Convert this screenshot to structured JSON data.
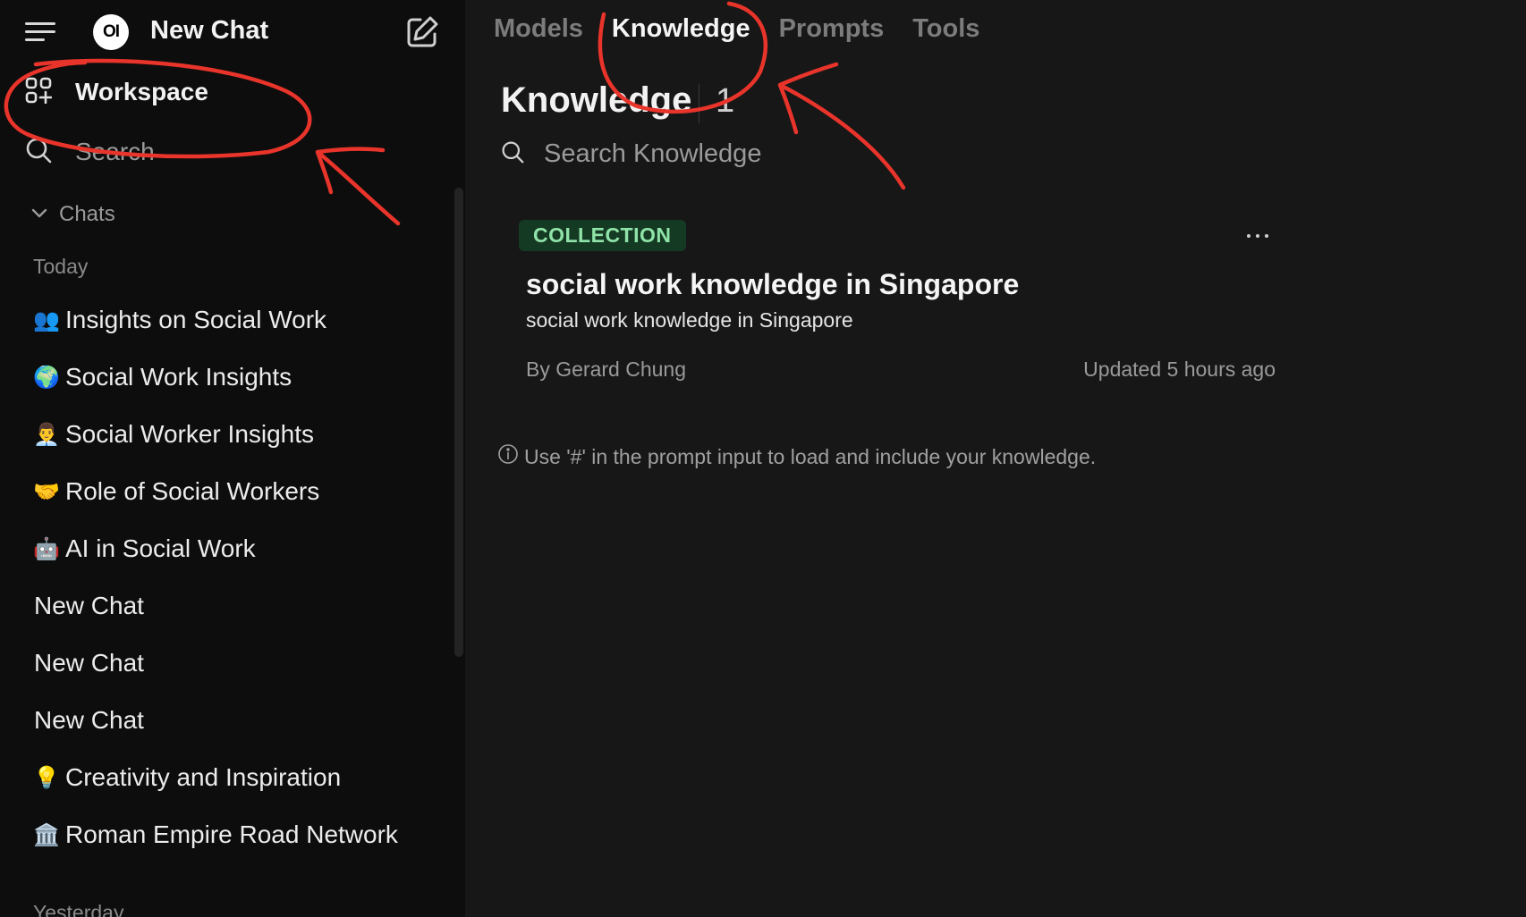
{
  "sidebar": {
    "app_title": "New Chat",
    "logo_text": "OI",
    "nav": {
      "workspace": "Workspace",
      "search": "Search"
    },
    "chats_header": "Chats",
    "groups": {
      "today": "Today",
      "yesterday": "Yesterday"
    },
    "chats": [
      {
        "emoji": "👥",
        "title": "Insights on Social Work"
      },
      {
        "emoji": "🌍",
        "title": "Social Work Insights"
      },
      {
        "emoji": "👨‍💼",
        "title": "Social Worker Insights"
      },
      {
        "emoji": "🤝",
        "title": "Role of Social Workers"
      },
      {
        "emoji": "🤖",
        "title": "AI in Social Work"
      },
      {
        "emoji": "",
        "title": "New Chat"
      },
      {
        "emoji": "",
        "title": "New Chat"
      },
      {
        "emoji": "",
        "title": "New Chat"
      },
      {
        "emoji": "💡",
        "title": "Creativity and Inspiration"
      },
      {
        "emoji": "🏛️",
        "title": "Roman Empire Road Network"
      }
    ]
  },
  "main": {
    "tabs": [
      {
        "label": "Models",
        "active": false
      },
      {
        "label": "Knowledge",
        "active": true
      },
      {
        "label": "Prompts",
        "active": false
      },
      {
        "label": "Tools",
        "active": false
      }
    ],
    "heading": "Knowledge",
    "count": "1",
    "search_placeholder": "Search Knowledge",
    "card": {
      "badge": "COLLECTION",
      "title": "social work knowledge in Singapore",
      "description": "social work knowledge in Singapore",
      "author": "By Gerard Chung",
      "updated": "Updated 5 hours ago"
    },
    "hint": "Use '#' in the prompt input to load and include your knowledge."
  },
  "icons": {
    "menu": "menu-icon",
    "edit": "edit-icon",
    "workspace": "grid-plus-icon",
    "search": "search-icon",
    "chevron": "chevron-down-icon",
    "more": "more-dots-icon",
    "info": "info-icon"
  },
  "colors": {
    "sidebar_bg": "#0d0d0d",
    "main_bg": "#171717",
    "badge_bg": "#153a23",
    "badge_text": "#8fe3a8",
    "annotation_red": "#e8342a"
  }
}
